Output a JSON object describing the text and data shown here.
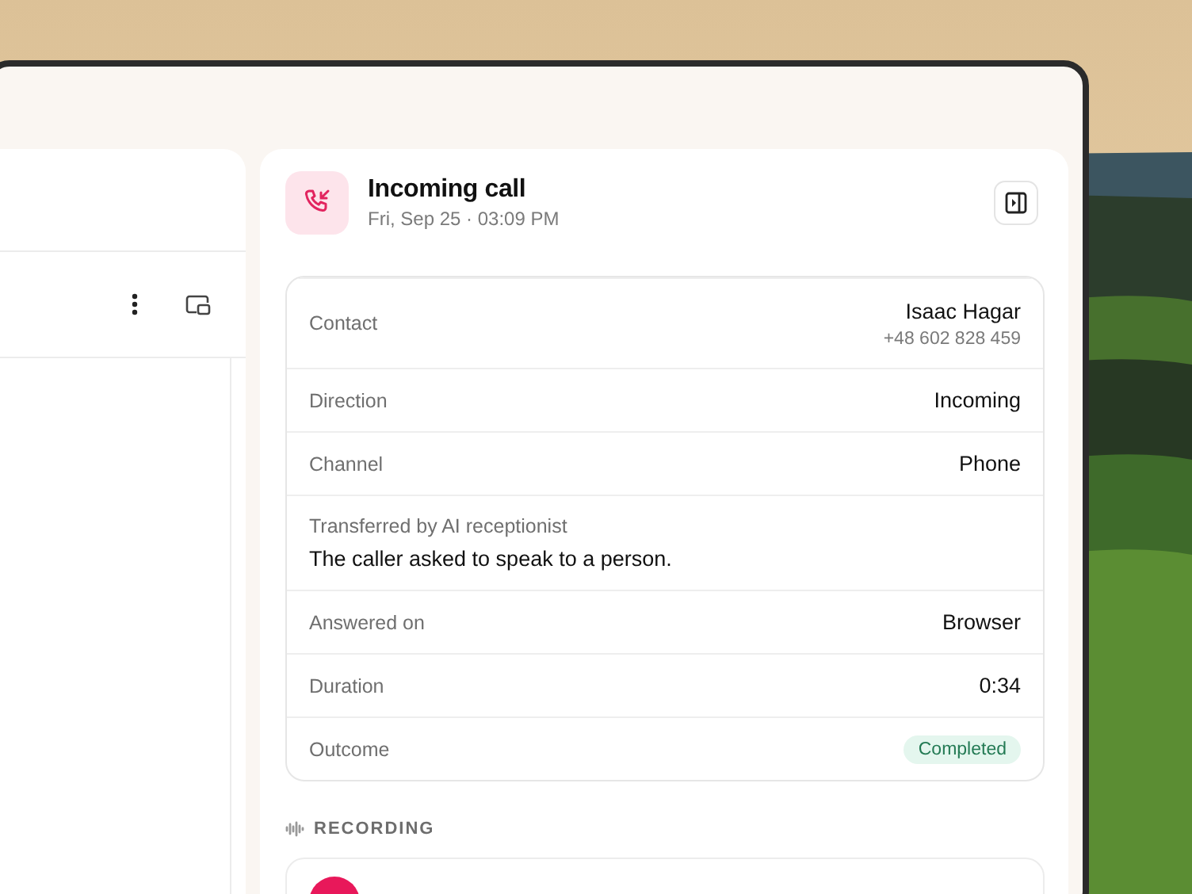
{
  "call": {
    "title": "Incoming call",
    "timestamp": "Fri, Sep 25 · 03:09 PM"
  },
  "details": [
    {
      "kind": "contact",
      "label": "Contact",
      "value": "Isaac Hagar",
      "sub": "+48 602 828 459"
    },
    {
      "kind": "pair",
      "label": "Direction",
      "value": "Incoming"
    },
    {
      "kind": "pair",
      "label": "Channel",
      "value": "Phone"
    },
    {
      "kind": "note",
      "label": "Transferred by AI receptionist",
      "value": "The caller asked to speak to a person."
    },
    {
      "kind": "pair",
      "label": "Answered on",
      "value": "Browser"
    },
    {
      "kind": "pair",
      "label": "Duration",
      "value": "0:34"
    },
    {
      "kind": "badge",
      "label": "Outcome",
      "value": "Completed"
    }
  ],
  "recording": {
    "label": "RECORDING"
  }
}
